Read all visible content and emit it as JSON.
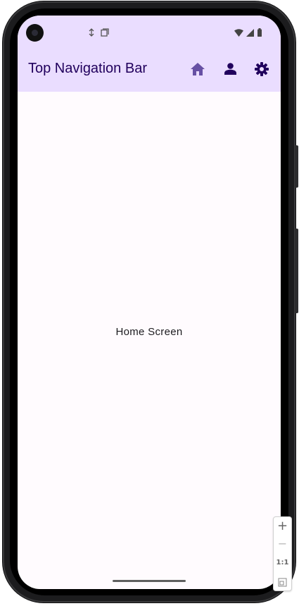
{
  "app_bar": {
    "title": "Top Navigation Bar",
    "actions": [
      {
        "name": "home",
        "icon": "home-icon",
        "color": "#6750a4"
      },
      {
        "name": "profile",
        "icon": "person-icon",
        "color": "#21005d"
      },
      {
        "name": "settings",
        "icon": "gear-icon",
        "color": "#21005d"
      }
    ],
    "background": "#eaddff"
  },
  "content": {
    "text": "Home Screen"
  },
  "status_bar": {
    "left_icons": [
      "data-saver-icon",
      "screenshot-icon"
    ],
    "right_icons": [
      "wifi-icon",
      "signal-icon",
      "battery-icon"
    ]
  },
  "zoom_controls": {
    "zoom_in": "+",
    "zoom_out": "−",
    "actual_size": "1:1"
  }
}
